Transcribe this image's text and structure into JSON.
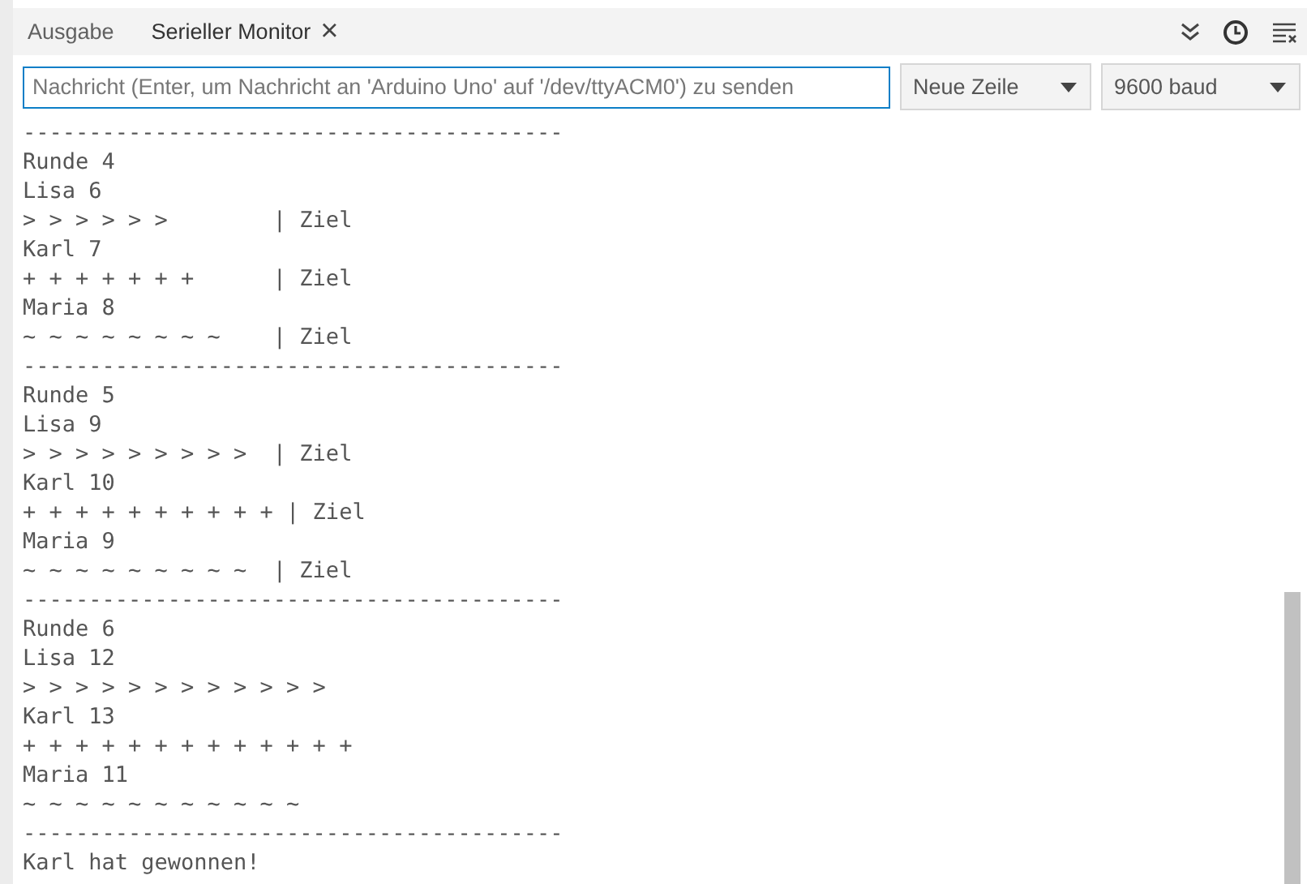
{
  "tabs": [
    {
      "label": "Ausgabe",
      "selected": false
    },
    {
      "label": "Serieller Monitor",
      "selected": true,
      "close_glyph": "×"
    }
  ],
  "message_field": {
    "placeholder": "Nachricht (Enter, um Nachricht an 'Arduino Uno' auf '/dev/ttyACM0') zu senden"
  },
  "line_ending": {
    "value": "Neue Zeile"
  },
  "baud_rate": {
    "value": "9600 baud"
  },
  "output": [
    "-----------------------------------------",
    "Runde 4",
    "Lisa 6",
    "> > > > > >        | Ziel",
    "Karl 7",
    "+ + + + + + +      | Ziel",
    "Maria 8",
    "~ ~ ~ ~ ~ ~ ~ ~    | Ziel",
    "-----------------------------------------",
    "Runde 5",
    "Lisa 9",
    "> > > > > > > > >  | Ziel",
    "Karl 10",
    "+ + + + + + + + + + | Ziel",
    "Maria 9",
    "~ ~ ~ ~ ~ ~ ~ ~ ~  | Ziel",
    "-----------------------------------------",
    "Runde 6",
    "Lisa 12",
    "> > > > > > > > > > > >",
    "Karl 13",
    "+ + + + + + + + + + + + +",
    "Maria 11",
    "~ ~ ~ ~ ~ ~ ~ ~ ~ ~ ~",
    "-----------------------------------------",
    "Karl hat gewonnen!"
  ]
}
